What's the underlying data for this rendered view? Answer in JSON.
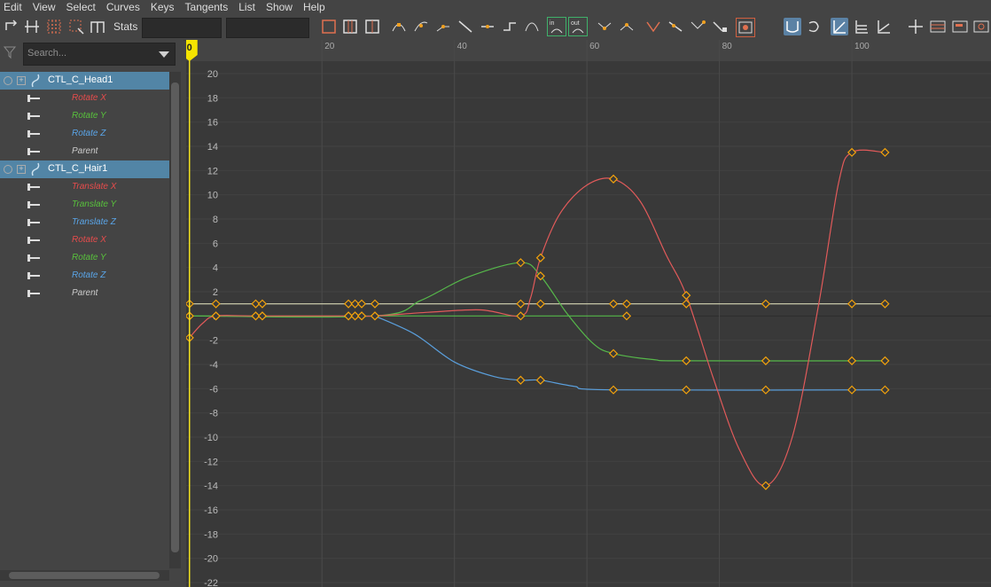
{
  "menu": [
    "Edit",
    "View",
    "Select",
    "Curves",
    "Keys",
    "Tangents",
    "List",
    "Show",
    "Help"
  ],
  "toolbar": {
    "stats_label": "Stats",
    "stats_value": "",
    "stats_value2": "",
    "tangent_in_label": "in",
    "tangent_out_label": "out"
  },
  "search": {
    "placeholder": "Search..."
  },
  "outliner": {
    "nodes": [
      {
        "name": "CTL_C_Head1",
        "attrs": [
          {
            "label": "Rotate X",
            "color": "#e64c4c"
          },
          {
            "label": "Rotate Y",
            "color": "#58c13c"
          },
          {
            "label": "Rotate Z",
            "color": "#5aa5e8"
          },
          {
            "label": "Parent",
            "color": "#cccccc"
          }
        ]
      },
      {
        "name": "CTL_C_Hair1",
        "attrs": [
          {
            "label": "Translate X",
            "color": "#e64c4c"
          },
          {
            "label": "Translate Y",
            "color": "#58c13c"
          },
          {
            "label": "Translate Z",
            "color": "#5aa5e8"
          },
          {
            "label": "Rotate X",
            "color": "#e64c4c"
          },
          {
            "label": "Rotate Y",
            "color": "#58c13c"
          },
          {
            "label": "Rotate Z",
            "color": "#5aa5e8"
          },
          {
            "label": "Parent",
            "color": "#cccccc"
          }
        ]
      }
    ]
  },
  "chart_data": {
    "type": "line",
    "current_frame": "0",
    "x_ticks": [
      "20",
      "40",
      "60",
      "80",
      "100"
    ],
    "x_tick_values": [
      20,
      40,
      60,
      80,
      100
    ],
    "y_ticks": [
      20,
      18,
      16,
      14,
      12,
      10,
      8,
      6,
      4,
      2,
      0,
      -2,
      -4,
      -6,
      -8,
      -10,
      -12,
      -14,
      -16,
      -18,
      -20,
      -22
    ],
    "xlim": [
      -0.5,
      121
    ],
    "ylim": [
      -22,
      22
    ],
    "series": [
      {
        "color": "#e15a5a",
        "keys": [
          [
            0,
            -1.8
          ],
          [
            4,
            0
          ],
          [
            10,
            0
          ],
          [
            11,
            0
          ],
          [
            24,
            0
          ],
          [
            25,
            0
          ],
          [
            26,
            0
          ],
          [
            28,
            0
          ],
          [
            50,
            0
          ],
          [
            53,
            4.8
          ],
          [
            64,
            11.3
          ],
          [
            75,
            1.7
          ],
          [
            87,
            -14
          ],
          [
            100,
            13.5
          ],
          [
            105,
            13.5
          ]
        ],
        "curve": [
          [
            0,
            -1.8
          ],
          [
            2,
            -0.6
          ],
          [
            4,
            0
          ],
          [
            10,
            0
          ],
          [
            24,
            0
          ],
          [
            28,
            0
          ],
          [
            36,
            0.3
          ],
          [
            44,
            0.5
          ],
          [
            50,
            0
          ],
          [
            51.5,
            1.5
          ],
          [
            53,
            4.8
          ],
          [
            56,
            8.5
          ],
          [
            60,
            10.8
          ],
          [
            64,
            11.3
          ],
          [
            68,
            9.5
          ],
          [
            72,
            5
          ],
          [
            75,
            1.7
          ],
          [
            79,
            -5
          ],
          [
            83,
            -11
          ],
          [
            87,
            -14
          ],
          [
            91,
            -10
          ],
          [
            95,
            1
          ],
          [
            98,
            11
          ],
          [
            100,
            13.5
          ],
          [
            105,
            13.5
          ]
        ]
      },
      {
        "color": "#56b84a",
        "keys": [
          [
            0,
            0
          ],
          [
            4,
            0
          ],
          [
            10,
            0
          ],
          [
            11,
            0
          ],
          [
            24,
            0
          ],
          [
            25,
            0
          ],
          [
            26,
            0
          ],
          [
            28,
            0
          ],
          [
            50,
            4.4
          ],
          [
            53,
            3.3
          ],
          [
            64,
            -3.1
          ],
          [
            75,
            -3.7
          ],
          [
            87,
            -3.7
          ],
          [
            100,
            -3.7
          ],
          [
            105,
            -3.7
          ]
        ],
        "curve": [
          [
            0,
            0
          ],
          [
            28,
            0
          ],
          [
            35,
            1.3
          ],
          [
            42,
            3.2
          ],
          [
            50,
            4.4
          ],
          [
            53,
            3.3
          ],
          [
            57,
            0.2
          ],
          [
            61,
            -2.3
          ],
          [
            64,
            -3.1
          ],
          [
            70,
            -3.6
          ],
          [
            75,
            -3.7
          ],
          [
            105,
            -3.7
          ]
        ]
      },
      {
        "color": "#5a9fdc",
        "keys": [
          [
            50,
            -5.3
          ],
          [
            53,
            -5.3
          ],
          [
            64,
            -6.1
          ],
          [
            75,
            -6.1
          ],
          [
            87,
            -6.1
          ],
          [
            100,
            -6.1
          ],
          [
            105,
            -6.1
          ]
        ],
        "curve": [
          [
            28,
            0
          ],
          [
            34,
            -1.5
          ],
          [
            40,
            -3.8
          ],
          [
            46,
            -5
          ],
          [
            50,
            -5.3
          ],
          [
            53,
            -5.3
          ],
          [
            58,
            -5.8
          ],
          [
            64,
            -6.1
          ],
          [
            105,
            -6.1
          ]
        ]
      },
      {
        "color": "#d7d7b4",
        "keys": [
          [
            0,
            1
          ],
          [
            4,
            1
          ],
          [
            10,
            1
          ],
          [
            11,
            1
          ],
          [
            24,
            1
          ],
          [
            25,
            1
          ],
          [
            26,
            1
          ],
          [
            28,
            1
          ],
          [
            50,
            1
          ],
          [
            53,
            1
          ],
          [
            64,
            1
          ],
          [
            66,
            1
          ],
          [
            75,
            1
          ],
          [
            87,
            1
          ],
          [
            100,
            1
          ],
          [
            105,
            1
          ]
        ],
        "curve": [
          [
            0,
            1
          ],
          [
            105,
            1
          ]
        ]
      },
      {
        "color": "#56b84a",
        "keys": [
          [
            0,
            0
          ],
          [
            66,
            0
          ]
        ],
        "curve": [
          [
            0,
            0
          ],
          [
            66,
            0
          ]
        ]
      }
    ]
  }
}
